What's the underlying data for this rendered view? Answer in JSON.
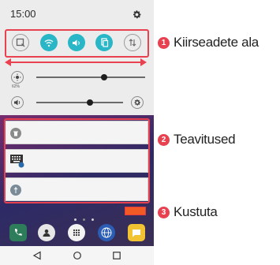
{
  "status_bar": {
    "time": "15:00",
    "settings_icon": "gear-icon"
  },
  "quick_settings": {
    "items": [
      {
        "name": "screenshot",
        "icon": "screenshot-icon",
        "state": "off"
      },
      {
        "name": "wifi",
        "icon": "wifi-icon",
        "state": "on"
      },
      {
        "name": "sound",
        "icon": "volume-icon",
        "state": "on"
      },
      {
        "name": "data",
        "icon": "data-icon",
        "state": "on"
      },
      {
        "name": "sync",
        "icon": "sync-icon",
        "state": "off"
      }
    ]
  },
  "sliders": {
    "brightness": {
      "icon": "brightness-icon",
      "percent_label": "62%",
      "level": 0.62
    },
    "volume": {
      "icon": "volume-icon",
      "level": 0.62,
      "settings_icon": "gear-icon"
    }
  },
  "notifications": [
    {
      "icon": "trash-icon"
    },
    {
      "icon": "keyboard-icon"
    },
    {
      "icon": "usb-icon"
    }
  ],
  "home": {
    "clear_button_color": "#f15a24",
    "dock": [
      "phone-icon",
      "contacts-icon",
      "apps-icon",
      "browser-icon",
      "messages-icon"
    ]
  },
  "navbar": {
    "buttons": [
      "back-icon",
      "home-icon",
      "recents-icon"
    ]
  },
  "callouts": [
    {
      "number": "1",
      "label": "Kiirseadete ala"
    },
    {
      "number": "2",
      "label": "Teavitused"
    },
    {
      "number": "3",
      "label": "Kustuta"
    }
  ],
  "colors": {
    "accent": "#e8414f",
    "toggle_on": "#29b6c6"
  }
}
